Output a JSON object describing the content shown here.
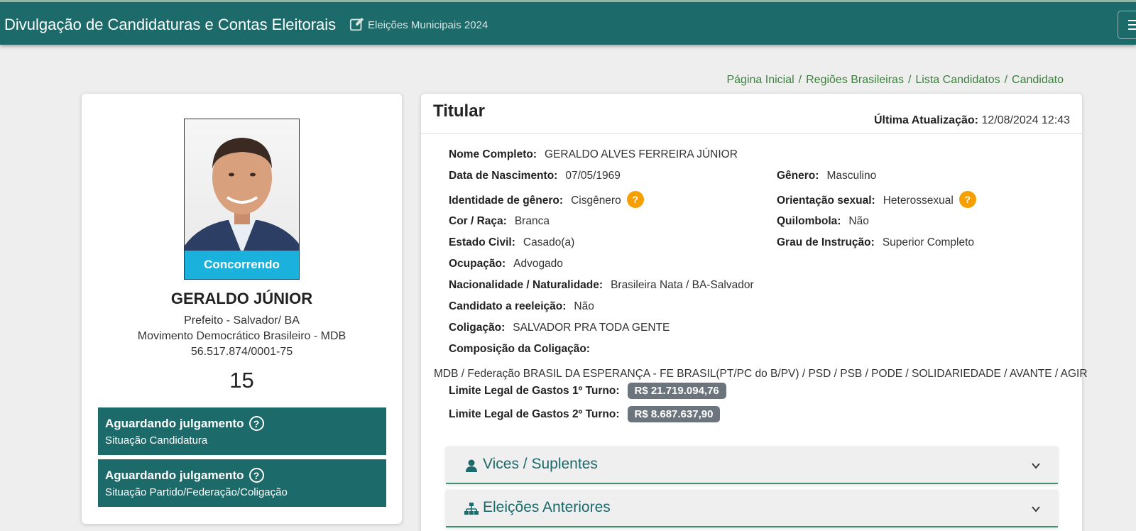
{
  "header": {
    "title": "Divulgação de Candidaturas e Contas Eleitorais",
    "election": "Eleições Municipais 2024",
    "edit_icon": "edit-icon",
    "menu_icon": "hamburger-menu-icon"
  },
  "breadcrumb": [
    "Página Inicial",
    "Regiões Brasileiras",
    "Lista Candidatos",
    "Candidato"
  ],
  "candidate": {
    "status_badge": "Concorrendo",
    "name": "GERALDO JÚNIOR",
    "office": "Prefeito - Salvador/ BA",
    "party": "Movimento Democrático Brasileiro - MDB",
    "cnpj": "56.517.874/0001-75",
    "number": "15",
    "status_boxes": [
      {
        "title": "Aguardando julgamento",
        "subtitle": "Situação Candidatura"
      },
      {
        "title": "Aguardando julgamento",
        "subtitle": "Situação Partido/Federação/Coligação"
      }
    ]
  },
  "details": {
    "section_title": "Titular",
    "updated_label": "Última Atualização:",
    "updated_value": "12/08/2024 12:43",
    "fields": {
      "nome": {
        "label": "Nome Completo:",
        "value": "GERALDO ALVES FERREIRA JÚNIOR"
      },
      "nascimento": {
        "label": "Data de Nascimento:",
        "value": "07/05/1969"
      },
      "genero": {
        "label": "Gênero:",
        "value": "Masculino"
      },
      "identidade": {
        "label": "Identidade de gênero:",
        "value": "Cisgênero"
      },
      "orientacao": {
        "label": "Orientação sexual:",
        "value": "Heterossexual"
      },
      "cor": {
        "label": "Cor / Raça:",
        "value": "Branca"
      },
      "quilombola": {
        "label": "Quilombola:",
        "value": "Não"
      },
      "estado_civil": {
        "label": "Estado Civil:",
        "value": "Casado(a)"
      },
      "instrucao": {
        "label": "Grau de Instrução:",
        "value": "Superior Completo"
      },
      "ocupacao": {
        "label": "Ocupação:",
        "value": "Advogado"
      },
      "nacionalidade": {
        "label": "Nacionalidade / Naturalidade:",
        "value": "Brasileira Nata / BA-Salvador"
      },
      "reeleicao": {
        "label": "Candidato a reeleição:",
        "value": "Não"
      },
      "coligacao": {
        "label": "Coligação:",
        "value": "SALVADOR PRA TODA GENTE"
      },
      "composicao": {
        "label": "Composição da Coligação:",
        "value": "MDB / Federação BRASIL DA ESPERANÇA - FE BRASIL(PT/PC do B/PV) / PSD / PSB / PODE / SOLIDARIEDADE / AVANTE / AGIR"
      },
      "limite1": {
        "label": "Limite Legal de Gastos 1º Turno:",
        "value": "R$ 21.719.094,76"
      },
      "limite2": {
        "label": "Limite Legal de Gastos 2º Turno:",
        "value": "R$ 8.687.637,90"
      }
    },
    "help_mark": "?"
  },
  "accordions": [
    {
      "title": "Vices / Suplentes",
      "icon": "user-icon"
    },
    {
      "title": "Eleições Anteriores",
      "icon": "sitemap-icon"
    }
  ],
  "colors": {
    "primary": "#1d6a6b",
    "badge_blue": "#1ab1dc",
    "help_orange": "#f5a000",
    "money_gray": "#6c757d",
    "breadcrumb_green": "#3f7f3f"
  }
}
